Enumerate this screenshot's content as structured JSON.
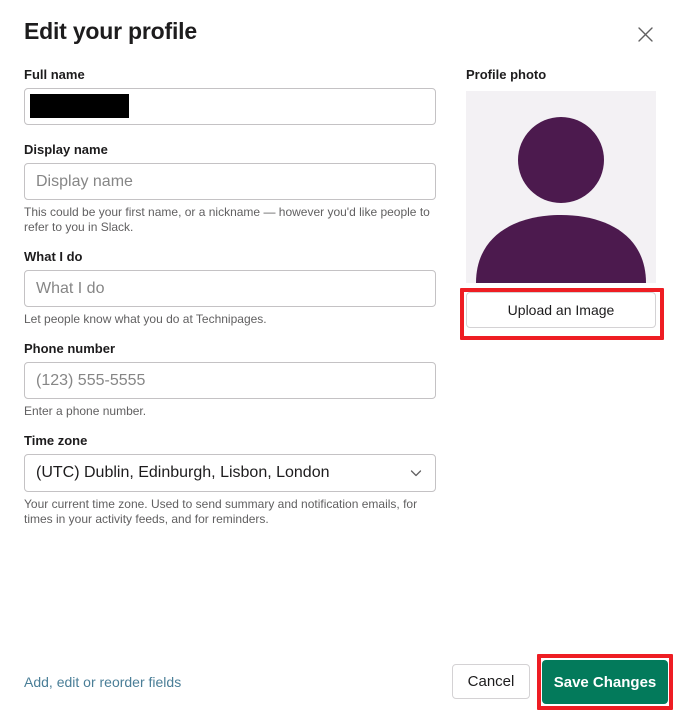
{
  "dialog": {
    "title": "Edit your profile",
    "close_icon": "close-icon"
  },
  "form": {
    "full_name": {
      "label": "Full name",
      "value": "",
      "placeholder": "",
      "redacted": true
    },
    "display_name": {
      "label": "Display name",
      "value": "",
      "placeholder": "Display name",
      "helper": "This could be your first name, or a nickname — however you'd like people to refer to you in Slack."
    },
    "what_i_do": {
      "label": "What I do",
      "value": "",
      "placeholder": "What I do",
      "helper": "Let people know what you do at Technipages."
    },
    "phone_number": {
      "label": "Phone number",
      "value": "",
      "placeholder": "(123) 555-5555",
      "helper": "Enter a phone number."
    },
    "time_zone": {
      "label": "Time zone",
      "selected": "(UTC) Dublin, Edinburgh, Lisbon, London",
      "helper": "Your current time zone. Used to send summary and notification emails, for times in your activity feeds, and for reminders.",
      "chevron_icon": "chevron-down-icon"
    }
  },
  "photo": {
    "label": "Profile photo",
    "avatar_icon": "person-avatar-icon",
    "avatar_color": "#4c1a4e",
    "avatar_bg": "#f3f1f4",
    "upload_label": "Upload an Image"
  },
  "footer": {
    "fields_link": "Add, edit or reorder fields",
    "cancel_label": "Cancel",
    "save_label": "Save Changes",
    "save_color": "#037a5b",
    "link_color": "#4a7e97"
  },
  "annotations": {
    "highlight_color": "#ee1d23",
    "targets": [
      "upload-an-image-button",
      "save-changes-button"
    ]
  }
}
